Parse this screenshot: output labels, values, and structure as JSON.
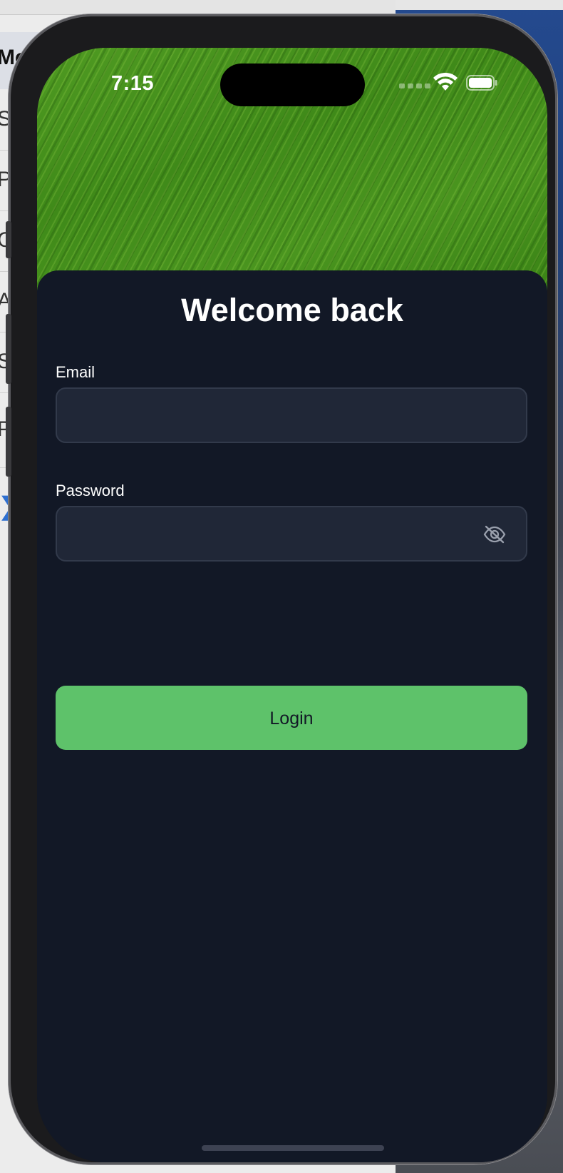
{
  "background_window": {
    "rows": [
      "Medi",
      "Stu",
      "Por",
      "Cre",
      "App",
      "Stu",
      "Pre"
    ]
  },
  "status_bar": {
    "time": "7:15"
  },
  "login": {
    "title": "Welcome back",
    "email_label": "Email",
    "email_value": "",
    "password_label": "Password",
    "password_value": "",
    "password_toggle_icon": "eye-off-icon",
    "login_button": "Login"
  },
  "colors": {
    "sheet_background": "#121826",
    "field_background": "#202737",
    "accent": "#5ec26a"
  }
}
